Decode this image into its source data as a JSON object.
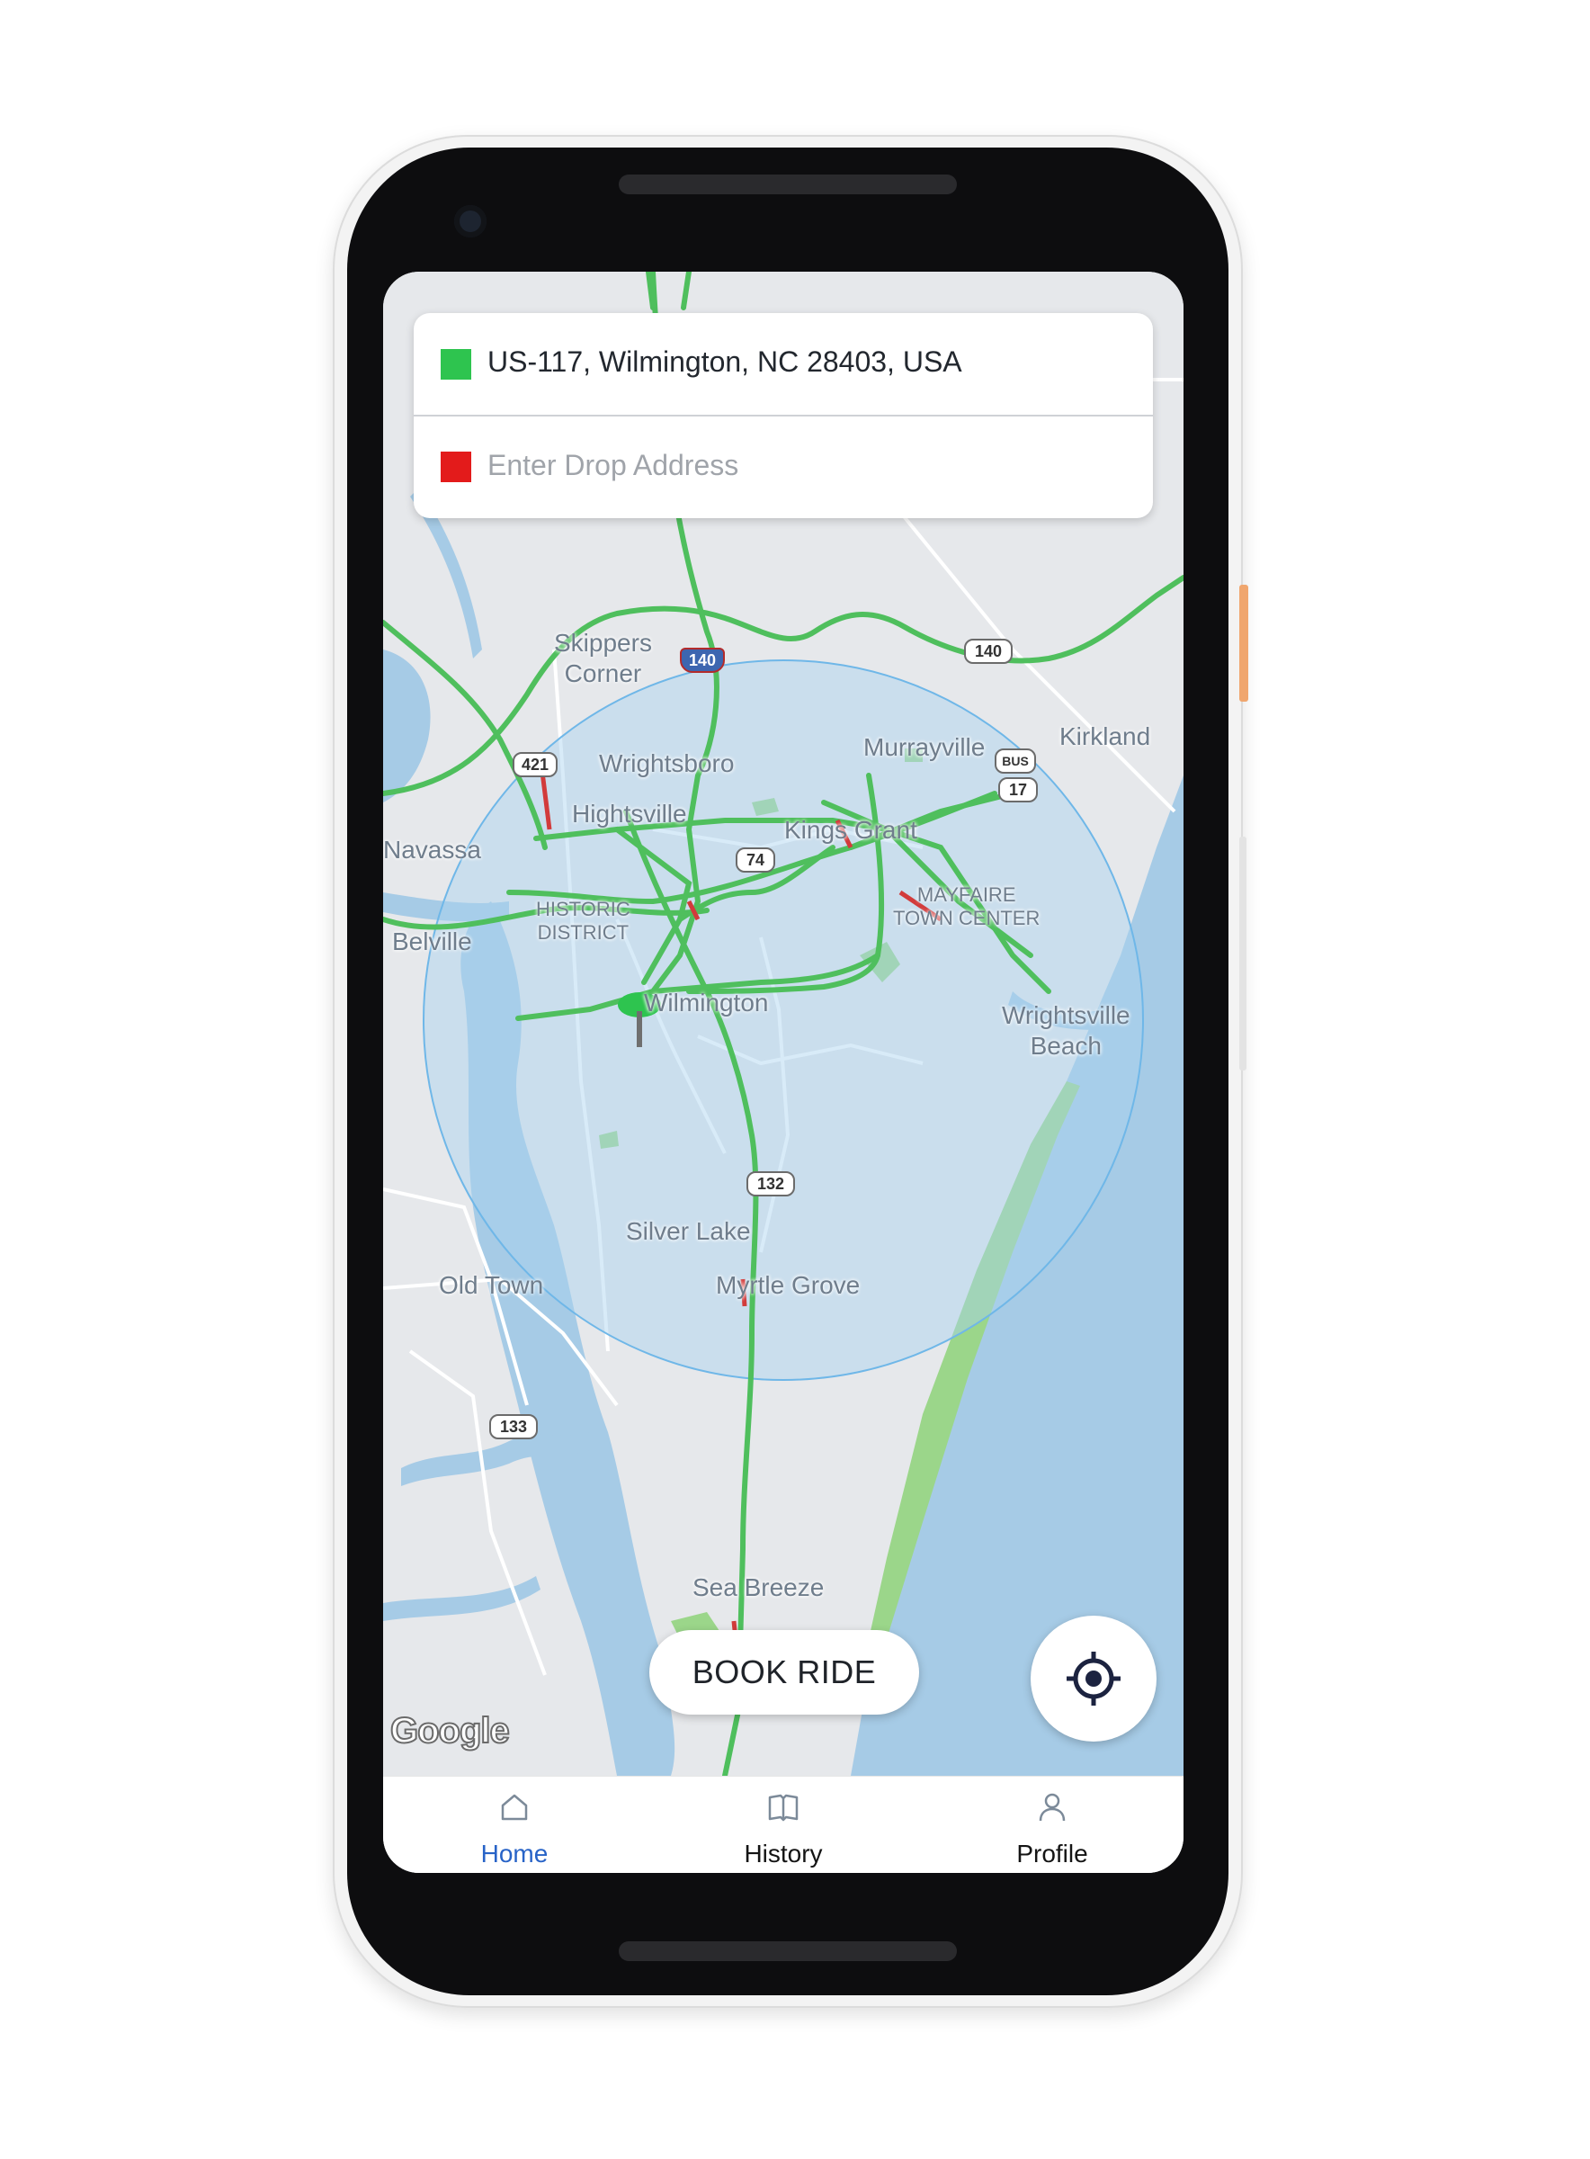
{
  "pickup": {
    "address": "US-117, Wilmington, NC 28403, USA",
    "marker_color": "#2ec44f"
  },
  "drop": {
    "placeholder": "Enter Drop Address",
    "marker_color": "#e31b1b"
  },
  "map": {
    "provider_logo": "Google",
    "place_labels": [
      "Skippers\nCorner",
      "Murrayville",
      "Kirkland",
      "Wrightsboro",
      "Hightsville",
      "Kings Grant",
      "Navassa",
      "HISTORIC\nDISTRICT",
      "MAYFAIRE\nTOWN CENTER",
      "Belville",
      "Wilmington",
      "Wrightsville\nBeach",
      "Silver Lake",
      "Old Town",
      "Myrtle Grove",
      "Sea Breeze"
    ],
    "road_shields": [
      "140",
      "140",
      "421",
      "BUS",
      "17",
      "74",
      "132",
      "133"
    ],
    "search_radius_color": "#a8d2f0"
  },
  "actions": {
    "book_ride_label": "BOOK RIDE",
    "locate_icon": "crosshair-icon"
  },
  "nav": {
    "active_color": "#2863c7",
    "items": [
      {
        "label": "Home",
        "icon": "home-icon",
        "active": true
      },
      {
        "label": "History",
        "icon": "book-icon",
        "active": false
      },
      {
        "label": "Profile",
        "icon": "user-icon",
        "active": false
      }
    ]
  }
}
